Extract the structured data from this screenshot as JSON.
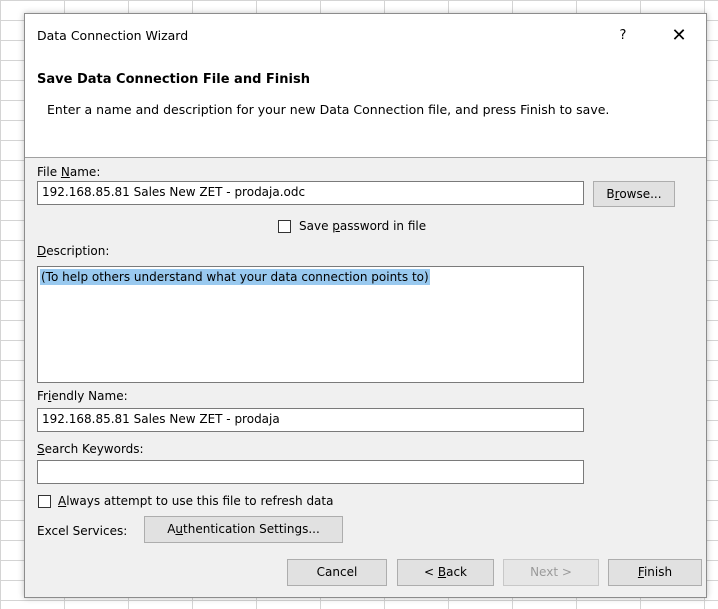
{
  "dialog": {
    "title": "Data Connection Wizard",
    "help_glyph": "?",
    "close_glyph": "✕"
  },
  "header": {
    "heading": "Save Data Connection File and Finish",
    "subheading": "Enter a name and description for your new Data Connection file, and press Finish to save."
  },
  "file_name": {
    "label_prefix": "File ",
    "label_mnemonic": "N",
    "label_suffix": "ame:",
    "value": "192.168.85.81 Sales New ZET - prodaja.odc",
    "browse_prefix": "B",
    "browse_mnemonic": "r",
    "browse_suffix": "owse..."
  },
  "save_password": {
    "label_prefix": "Save ",
    "label_mnemonic": "p",
    "label_suffix": "assword in file",
    "checked": false
  },
  "description": {
    "label_mnemonic": "D",
    "label_suffix": "escription:",
    "value": "(To help others understand what your data connection points to)"
  },
  "friendly_name": {
    "label_prefix": "Fr",
    "label_mnemonic": "i",
    "label_suffix": "endly Name:",
    "value": "192.168.85.81 Sales New ZET - prodaja"
  },
  "search_keywords": {
    "label_mnemonic": "S",
    "label_suffix": "earch Keywords:",
    "value": ""
  },
  "always_refresh": {
    "label_mnemonic": "A",
    "label_suffix": "lways attempt to use this file to refresh data",
    "checked": false
  },
  "excel_services": {
    "label": "Excel Services:",
    "auth_prefix": "A",
    "auth_mnemonic": "u",
    "auth_suffix": "thentication Settings..."
  },
  "footer": {
    "cancel": "Cancel",
    "back_prefix": "< ",
    "back_mnemonic": "B",
    "back_suffix": "ack",
    "next": "Next >",
    "finish_mnemonic": "F",
    "finish_suffix": "inish"
  }
}
